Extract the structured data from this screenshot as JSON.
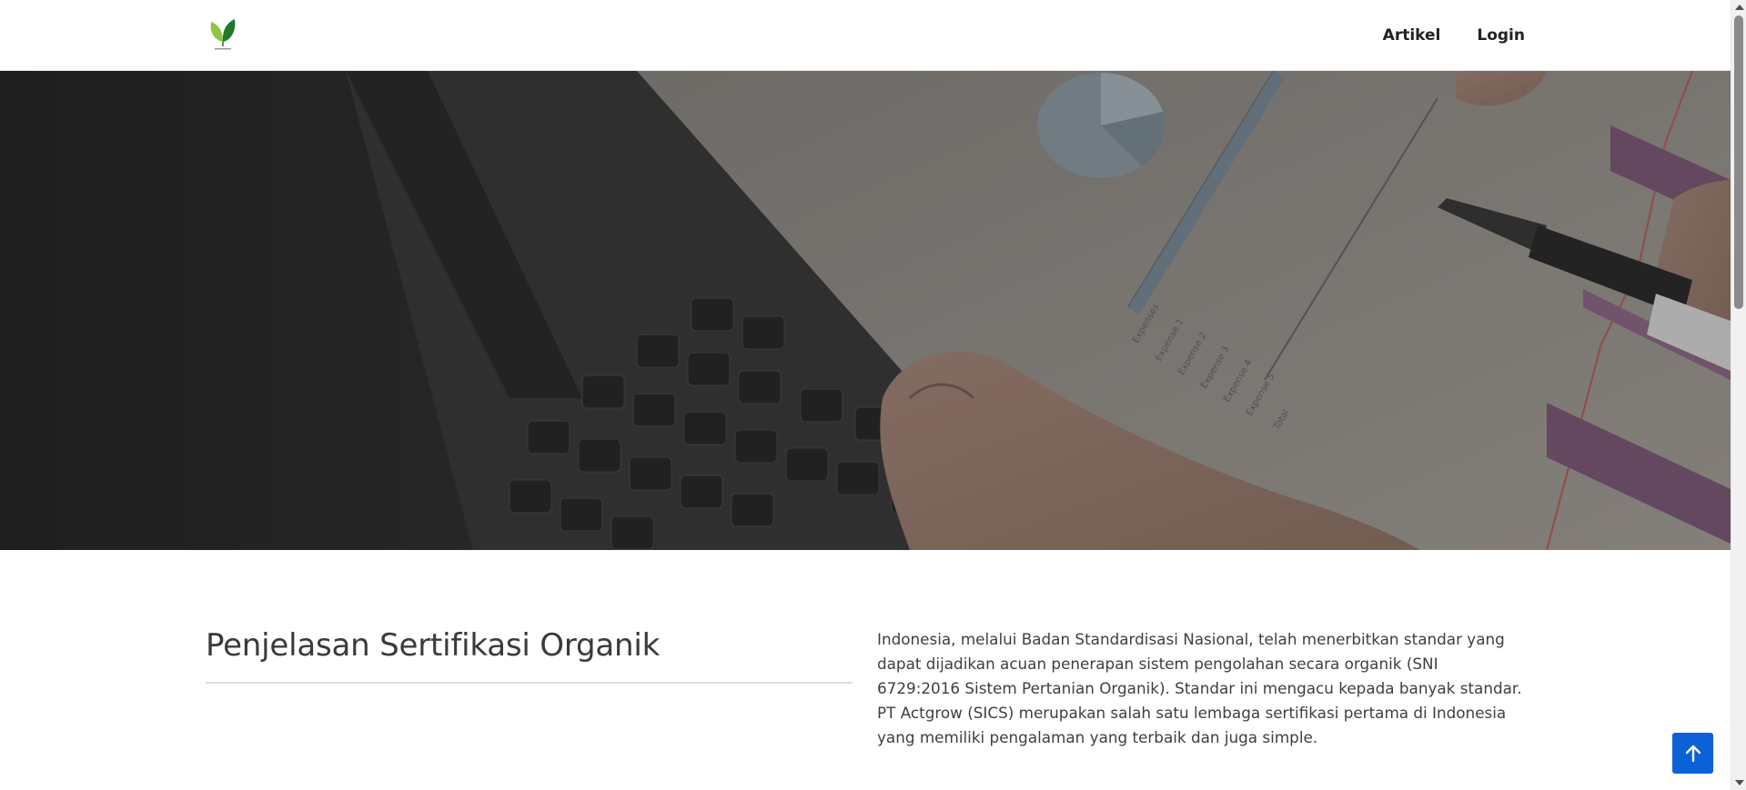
{
  "navbar": {
    "logo_icon": "leaf-logo-icon",
    "links": [
      {
        "label": "Artikel"
      },
      {
        "label": "Login"
      }
    ]
  },
  "hero": {
    "image": "laptop-and-financial-report-photo"
  },
  "section": {
    "title": "Penjelasan Sertifikasi Organik",
    "text": "Indonesia, melalui Badan Standardisasi Nasional, telah menerbitkan standar yang dapat dijadikan acuan penerapan sistem pengolahan secara organik (SNI 6729:2016 Sistem Pertanian Organik). Standar ini mengacu kepada banyak standar. PT Actgrow (SICS) merupakan salah satu lembaga sertifikasi pertama di Indonesia yang memiliki pengalaman yang terbaik dan juga simple."
  },
  "back_to_top": {
    "icon": "arrow-up-icon",
    "color": "#0b62d6"
  },
  "colors": {
    "accent": "#0b62d6",
    "leaf_dark": "#1f7a2a",
    "leaf_light": "#8dc63f"
  }
}
